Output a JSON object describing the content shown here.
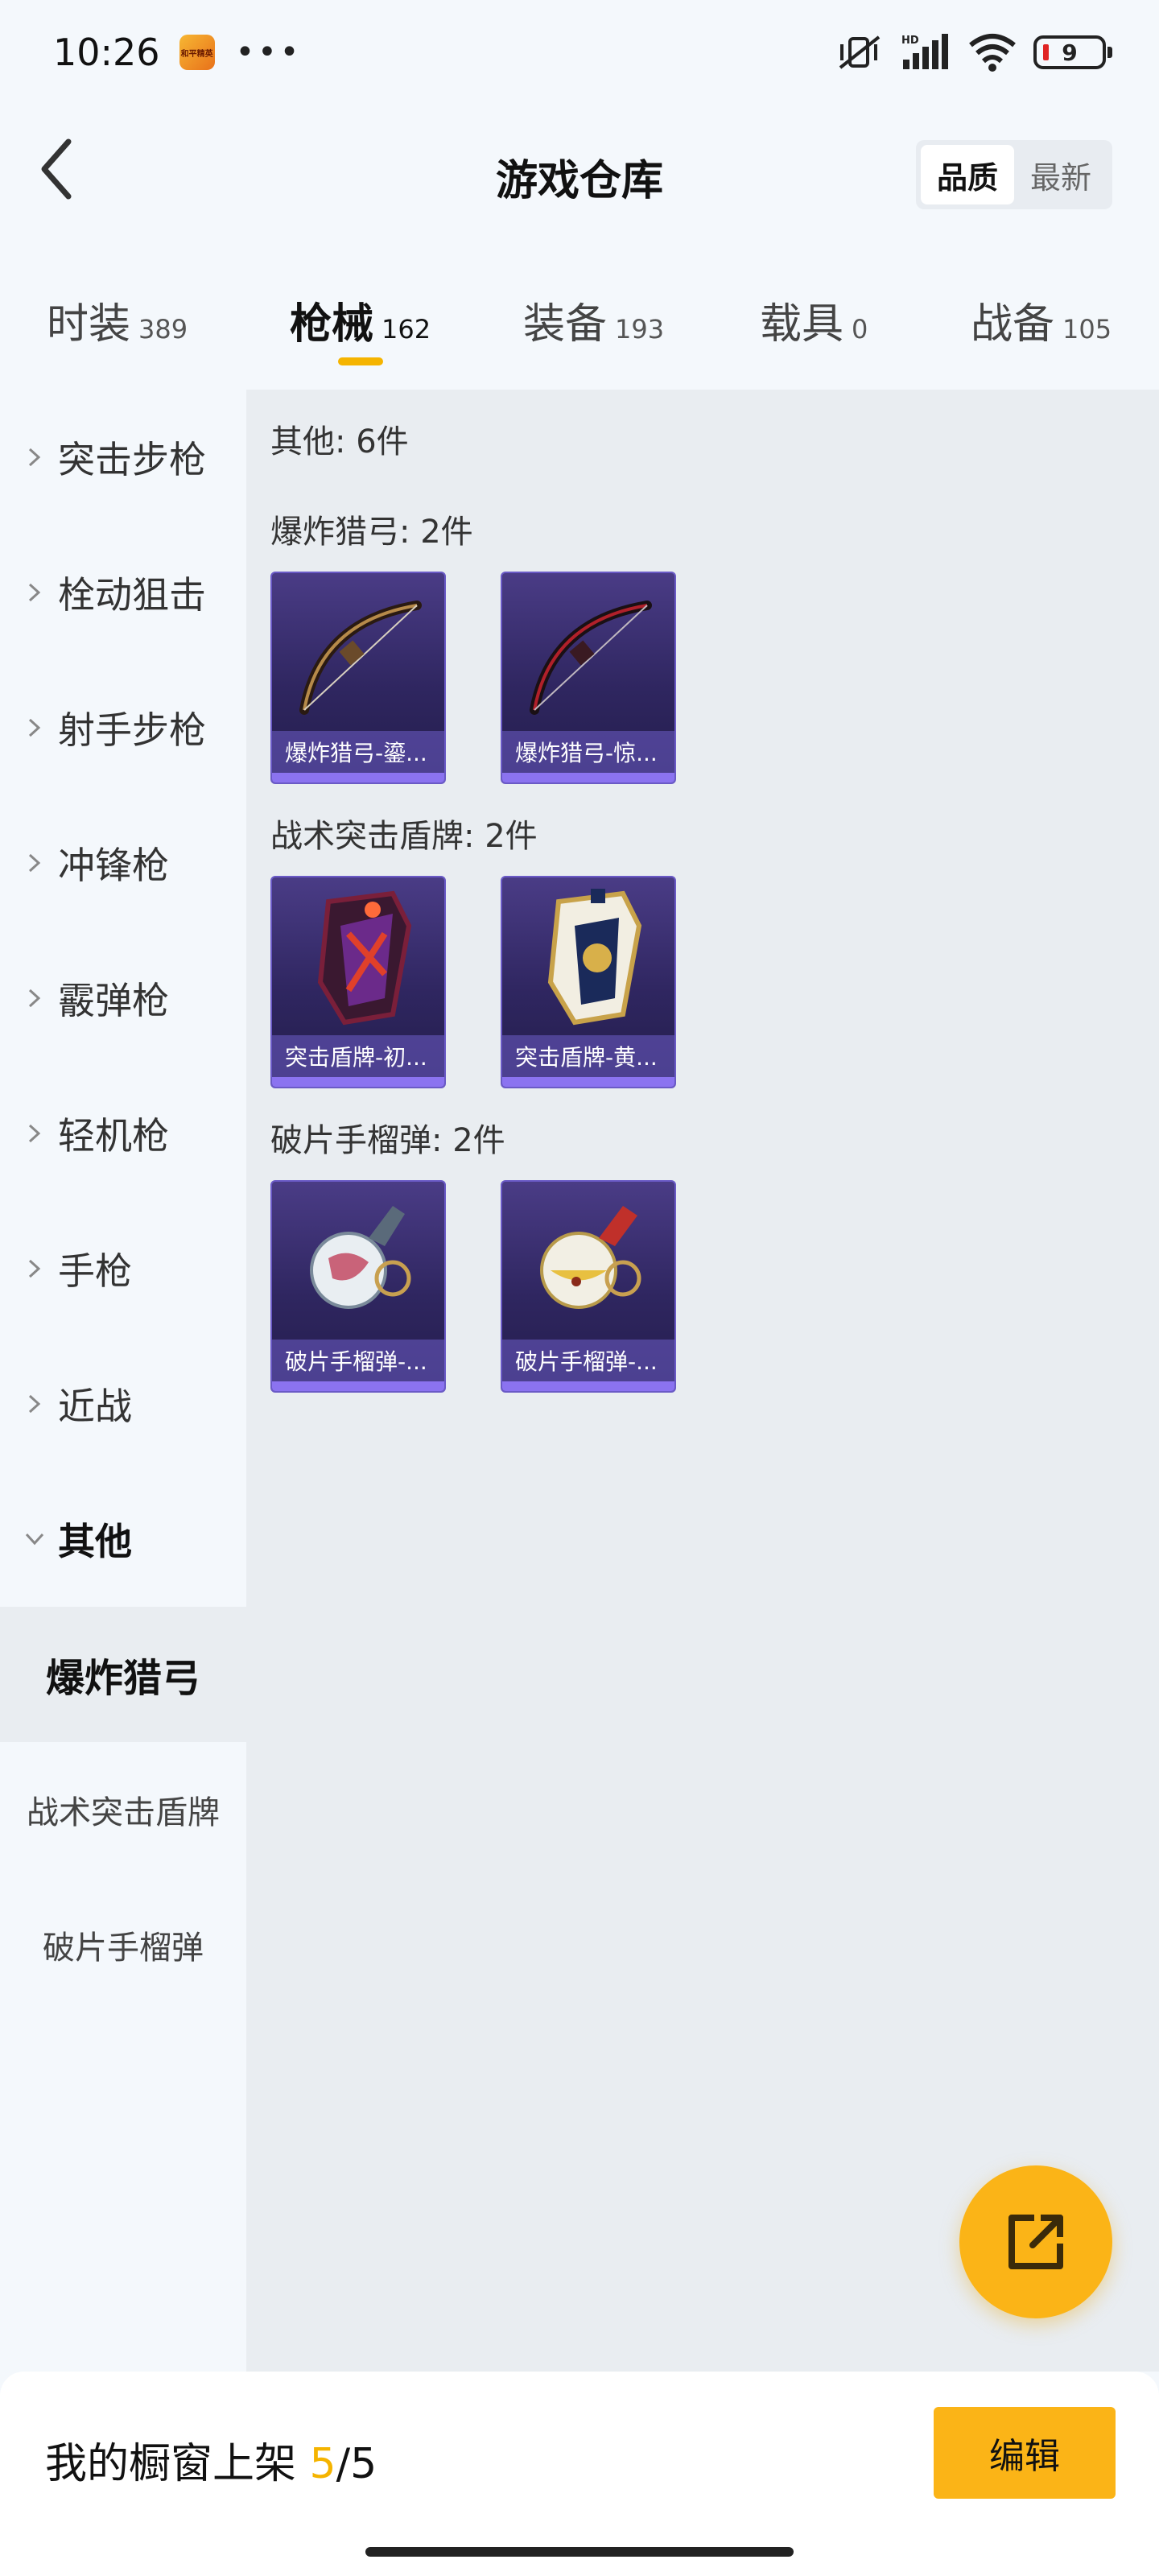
{
  "status_bar": {
    "time": "10:26",
    "app_badge_text": "和平精英",
    "more": "•••",
    "battery": "9",
    "icons": [
      "mute-vibrate-icon",
      "hd-signal-icon",
      "wifi-icon",
      "battery-icon"
    ]
  },
  "header": {
    "title": "游戏仓库",
    "sort_options": [
      {
        "label": "品质",
        "active": true
      },
      {
        "label": "最新",
        "active": false
      }
    ]
  },
  "tabs": [
    {
      "label": "时装",
      "count": "389"
    },
    {
      "label": "枪械",
      "count": "162",
      "active": true
    },
    {
      "label": "装备",
      "count": "193"
    },
    {
      "label": "载具",
      "count": "0"
    },
    {
      "label": "战备",
      "count": "105"
    }
  ],
  "sidebar": {
    "categories": [
      "突击步枪",
      "栓动狙击",
      "射手步枪",
      "冲锋枪",
      "霰弹枪",
      "轻机枪",
      "手枪",
      "近战",
      "其他"
    ],
    "expanded": "其他",
    "subcategories": [
      "爆炸猎弓",
      "战术突击盾牌",
      "破片手榴弹"
    ],
    "selected_sub": "爆炸猎弓"
  },
  "content": {
    "summary": "其他: 6件",
    "groups": [
      {
        "title": "爆炸猎弓: 2件",
        "items": [
          "爆炸猎弓-鎏...",
          "爆炸猎弓-惊..."
        ]
      },
      {
        "title": "战术突击盾牌: 2件",
        "items": [
          "突击盾牌-初...",
          "突击盾牌-黄..."
        ]
      },
      {
        "title": "破片手榴弹: 2件",
        "items": [
          "破片手榴弹-...",
          "破片手榴弹-..."
        ]
      }
    ]
  },
  "fab": {
    "icon": "share-export-icon"
  },
  "bottom_bar": {
    "label": "我的橱窗上架",
    "current": "5",
    "separator": "/",
    "total": "5",
    "edit_label": "编辑"
  },
  "colors": {
    "accent": "#fbb417",
    "card_bg": "#2f2660",
    "card_border": "#6a5ac6",
    "content_bg": "#e9edf1"
  }
}
